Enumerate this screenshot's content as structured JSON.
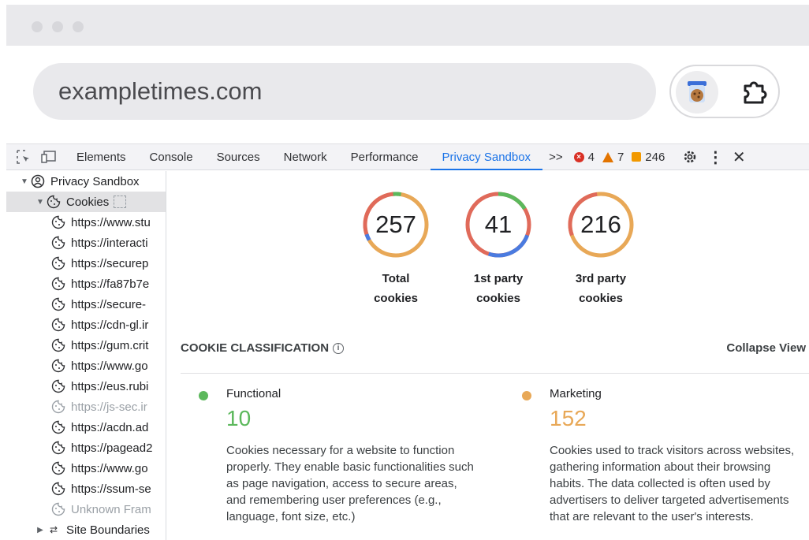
{
  "browser": {
    "url": "exampletimes.com",
    "extension_icon": "cookie-icon",
    "extensions_icon": "puzzle-icon"
  },
  "devtools": {
    "tabs": [
      "Elements",
      "Console",
      "Sources",
      "Network",
      "Performance",
      "Privacy Sandbox"
    ],
    "active_tab": "Privacy Sandbox",
    "more_tabs": ">>",
    "errors": "4",
    "warnings": "7",
    "issues": "246"
  },
  "sidebar": {
    "root": "Privacy Sandbox",
    "cookies": "Cookies",
    "frames": [
      {
        "label": "https://www.stu",
        "muted": false
      },
      {
        "label": "https://interacti",
        "muted": false
      },
      {
        "label": "https://securep",
        "muted": false
      },
      {
        "label": "https://fa87b7e",
        "muted": false
      },
      {
        "label": "https://secure-",
        "muted": false
      },
      {
        "label": "https://cdn-gl.ir",
        "muted": false
      },
      {
        "label": "https://gum.crit",
        "muted": false
      },
      {
        "label": "https://www.go",
        "muted": false
      },
      {
        "label": "https://eus.rubi",
        "muted": false
      },
      {
        "label": "https://js-sec.ir",
        "muted": true
      },
      {
        "label": "https://acdn.ad",
        "muted": false
      },
      {
        "label": "https://pagead2",
        "muted": false
      },
      {
        "label": "https://www.go",
        "muted": false
      },
      {
        "label": "https://ssum-se",
        "muted": false
      },
      {
        "label": "Unknown Fram",
        "muted": true
      }
    ],
    "site_boundaries": "Site Boundaries"
  },
  "summary": [
    {
      "value": "257",
      "label_line1": "Total",
      "label_line2": "cookies"
    },
    {
      "value": "41",
      "label_line1": "1st party",
      "label_line2": "cookies"
    },
    {
      "value": "216",
      "label_line1": "3rd party",
      "label_line2": "cookies"
    }
  ],
  "classification": {
    "heading": "COOKIE CLASSIFICATION",
    "collapse": "Collapse View",
    "cards": [
      {
        "title": "Functional",
        "count": "10",
        "color": "#5cb85c",
        "description": "Cookies necessary for a website to function properly. They enable basic functionalities such as page navigation, access to secure areas, and remembering user preferences (e.g., language, font size, etc.)"
      },
      {
        "title": "Marketing",
        "count": "152",
        "color": "#e8a857",
        "description": "Cookies used to track visitors across websites, gathering information about their browsing habits. The data collected is often used by advertisers to deliver targeted advertisements that are relevant to the user's interests."
      }
    ]
  },
  "colors": {
    "accent": "#1a73e8",
    "functional": "#5cb85c",
    "marketing": "#e8a857",
    "analytics": "#4a7be0",
    "uncategorized": "#e06a5a"
  }
}
